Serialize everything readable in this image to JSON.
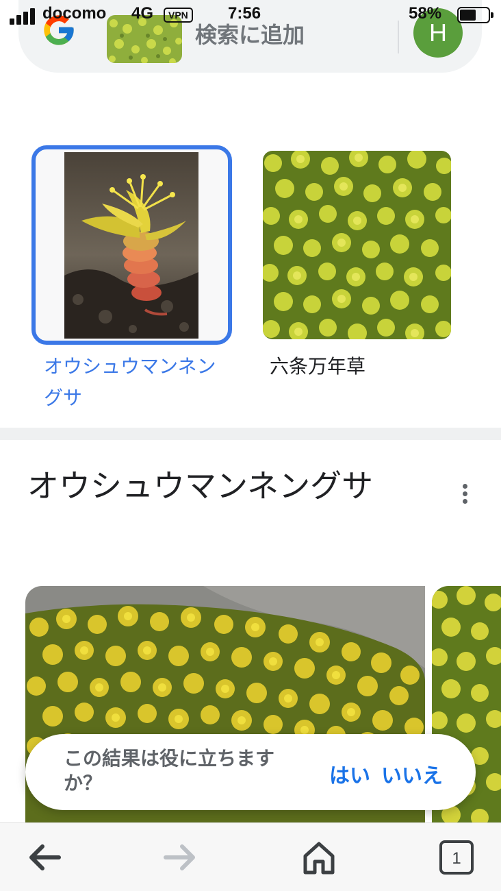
{
  "status_bar": {
    "carrier": "docomo",
    "network": "4G",
    "vpn": "VPN",
    "time": "7:56",
    "battery_percent": "58%",
    "battery_level": 0.58
  },
  "search_bar": {
    "add_to_search": "検索に追加",
    "avatar_initial": "H"
  },
  "results": [
    {
      "label": "オウシュウマンネングサ",
      "selected": true
    },
    {
      "label": "六条万年草",
      "selected": false
    }
  ],
  "knowledge_panel": {
    "title": "オウシュウマンネングサ"
  },
  "feedback": {
    "question": "この結果は役に立ちますか？",
    "yes": "はい",
    "no": "いいえ"
  },
  "toolbar": {
    "tab_count": "1",
    "icons": [
      "back-arrow-icon",
      "forward-arrow-icon",
      "home-icon",
      "tabs-icon"
    ]
  },
  "colors": {
    "accent": "#3b78e7",
    "link": "#1a73e8",
    "avatar_bg": "#5a9e3c"
  }
}
